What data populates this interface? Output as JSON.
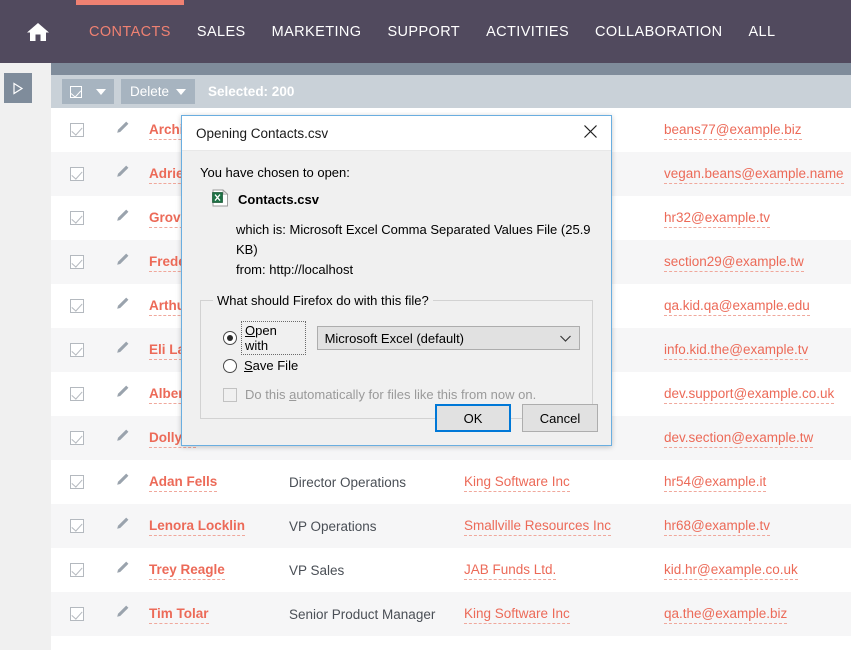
{
  "nav": {
    "home_icon": "home-icon",
    "items": [
      {
        "label": "CONTACTS",
        "active": true
      },
      {
        "label": "SALES",
        "active": false
      },
      {
        "label": "MARKETING",
        "active": false
      },
      {
        "label": "SUPPORT",
        "active": false
      },
      {
        "label": "ACTIVITIES",
        "active": false
      },
      {
        "label": "COLLABORATION",
        "active": false
      },
      {
        "label": "ALL",
        "active": false
      }
    ],
    "accent_color": "#ef8172",
    "bar_color": "#514a5e"
  },
  "left_rail": {
    "toggle_icon": "play-triangle-icon"
  },
  "toolbar": {
    "select_all_icon": "checkbox-checked-icon",
    "select_all_caret_icon": "caret-down-icon",
    "delete_label": "Delete",
    "delete_caret_icon": "caret-down-icon",
    "status": "Selected: 200"
  },
  "table": {
    "row_check_icon": "checkbox-checked-icon",
    "row_edit_icon": "pencil-icon",
    "rows": [
      {
        "name": "Archie",
        "title": "",
        "company": "",
        "email": "beans77@example.biz"
      },
      {
        "name": "Adrienn",
        "title": "",
        "company": "",
        "email": "vegan.beans@example.name"
      },
      {
        "name": "Grover",
        "title": "",
        "company": "",
        "email": "hr32@example.tv"
      },
      {
        "name": "Frederi",
        "title": "",
        "company": "",
        "email": "section29@example.tw"
      },
      {
        "name": "Arthur",
        "title": "",
        "company": "",
        "email": "qa.kid.qa@example.edu"
      },
      {
        "name": "Eli Lam",
        "title": "",
        "company": "",
        "email": "info.kid.the@example.tv"
      },
      {
        "name": "Alberto",
        "title": "",
        "company": "",
        "email": "dev.support@example.co.uk"
      },
      {
        "name": "Dolly C",
        "title": "",
        "company": "",
        "email": "dev.section@example.tw"
      },
      {
        "name": "Adan Fells",
        "title": "Director Operations",
        "company": "King Software Inc",
        "email": "hr54@example.it"
      },
      {
        "name": "Lenora Locklin",
        "title": "VP Operations",
        "company": "Smallville Resources Inc",
        "email": "hr68@example.tv"
      },
      {
        "name": "Trey Reagle",
        "title": "VP Sales",
        "company": "JAB Funds Ltd.",
        "email": "kid.hr@example.co.uk"
      },
      {
        "name": "Tim Tolar",
        "title": "Senior Product Manager",
        "company": "King Software Inc",
        "email": "qa.the@example.biz"
      }
    ],
    "link_color": "#ec6a58"
  },
  "dialog": {
    "title": "Opening Contacts.csv",
    "close_icon": "close-icon",
    "chosen_to_open": "You have chosen to open:",
    "file_icon": "excel-file-icon",
    "file_name": "Contacts.csv",
    "which_is_label": "which is:",
    "which_is_value": "Microsoft Excel Comma Separated Values File (25.9 KB)",
    "from_label": "from:",
    "from_value": "http://localhost",
    "fieldset_legend": "What should Firefox do with this file?",
    "open_with_label": "Open with",
    "open_with_accesskey": "O",
    "open_with_selected": true,
    "app_select_value": "Microsoft Excel (default)",
    "app_select_chevron_icon": "chevron-down-icon",
    "save_file_label": "Save File",
    "save_file_accesskey": "S",
    "auto_checkbox_label": "Do this automatically for files like this from now on.",
    "auto_checkbox_accesskey": "a",
    "auto_checkbox_checked": false,
    "ok_label": "OK",
    "cancel_label": "Cancel",
    "border_color": "#6aaee0",
    "focus_color": "#0078d7"
  }
}
